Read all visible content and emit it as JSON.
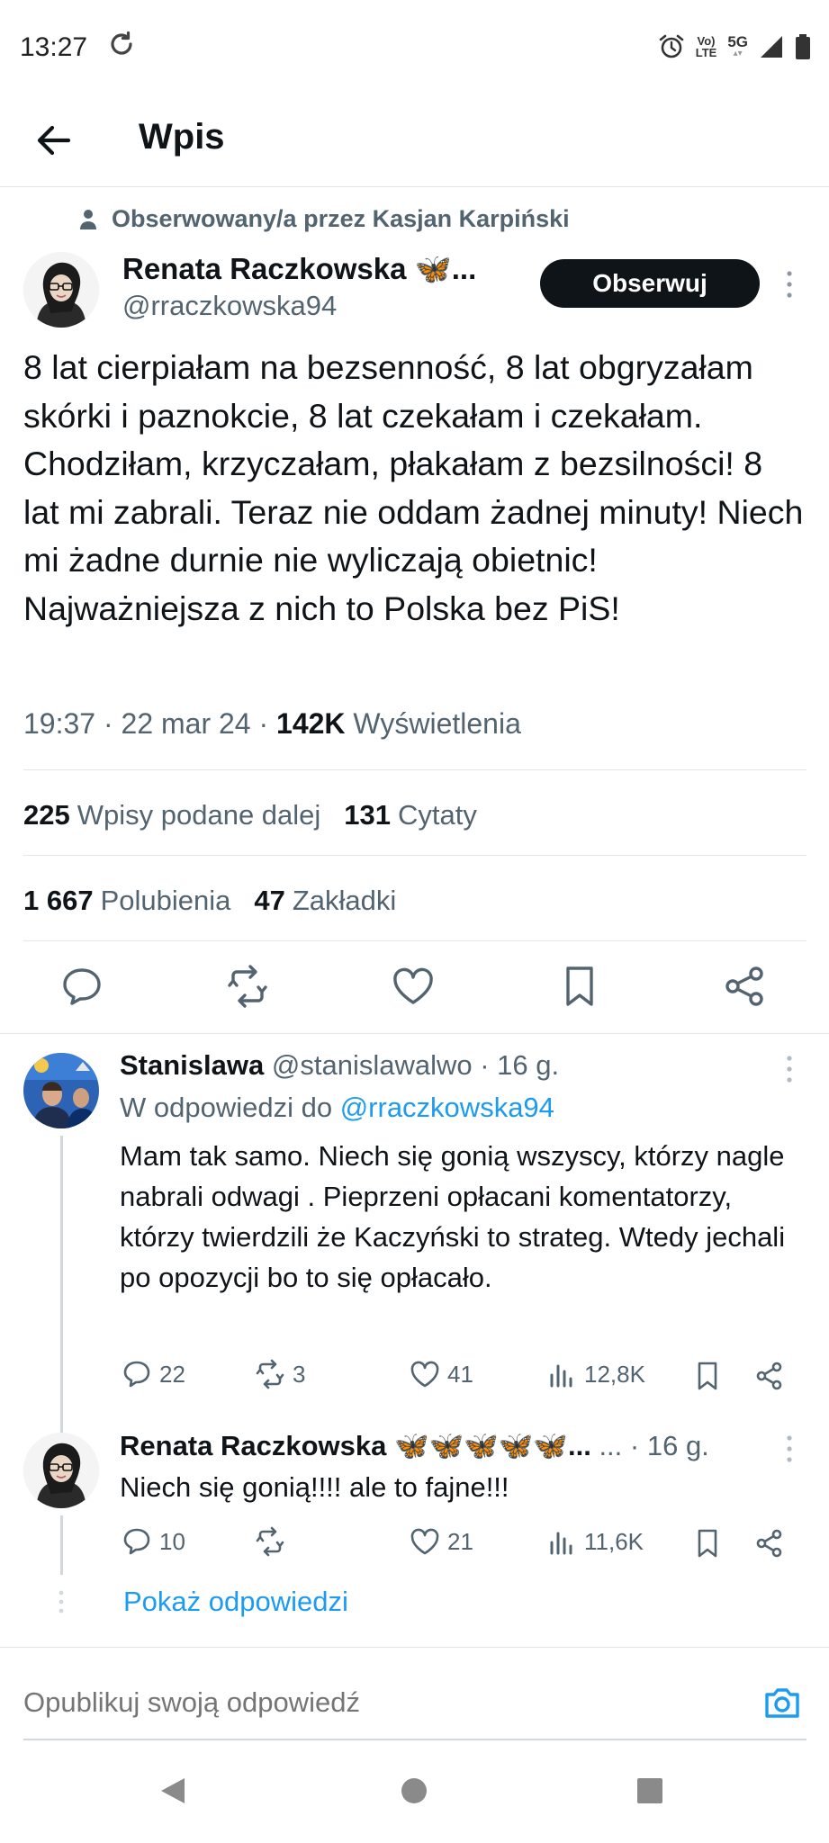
{
  "status_bar": {
    "time": "13:27",
    "network": "Vo​LTE",
    "network_top": "Vo)",
    "network_bottom": "LTE",
    "signal_type": "5G",
    "icons": [
      "sync-icon",
      "alarm-icon",
      "volte-icon",
      "signal-icon",
      "battery-icon"
    ]
  },
  "app_bar": {
    "title": "Wpis",
    "back_icon": "arrow-left-icon"
  },
  "tweet": {
    "followed_by": "Obserwowany/a przez Kasjan Karpiński",
    "author_name": "Renata Raczkowska 🦋...",
    "author_handle": "@rraczkowska94",
    "follow_label": "Obserwuj",
    "text": "8 lat cierpiałam na bezsenność, 8 lat obgryzałam skórki i paznokcie, 8 lat czekałam i czekałam. Chodziłam, krzyczałam, płakałam z bezsilności! 8 lat mi zabrali. Teraz nie oddam żadnej minuty! Niech mi żadne durnie nie wyliczają obietnic! Najważniejsza z nich to Polska bez PiS!",
    "time": "19:37",
    "date": "22 mar 24",
    "views_count": "142K",
    "views_label": "Wyświetlenia",
    "reposts_count": "225",
    "reposts_label": "Wpisy podane dalej",
    "quotes_count": "131",
    "quotes_label": "Cytaty",
    "likes_count": "1 667",
    "likes_label": "Polubienia",
    "bookmarks_count": "47",
    "bookmarks_label": "Zakładki"
  },
  "replies": [
    {
      "name": "Stanislawa",
      "handle": "@stanislawalwo",
      "time": "16 g.",
      "reply_to_label": "W odpowiedzi do",
      "reply_to_handle": "@rraczkowska94",
      "text": "Mam tak samo. Niech się gonią wszyscy, którzy nagle nabrali odwagi . Pieprzeni opłacani komentatorzy, którzy twierdzili że Kaczyński to strateg. Wtedy jechali po opozycji bo to się opłacało.",
      "replies": "22",
      "reposts": "3",
      "likes": "41",
      "views": "12,8K"
    },
    {
      "name": "Renata Raczkowska 🦋🦋🦋🦋🦋...",
      "handle_ellipsis": "...",
      "time": "16 g.",
      "text": "Niech się gonią!!!! ale to fajne!!!",
      "replies": "10",
      "reposts": "",
      "likes": "21",
      "views": "11,6K"
    }
  ],
  "show_replies": "Pokaż odpowiedzi",
  "compose": {
    "placeholder": "Opublikuj swoją odpowiedź"
  },
  "colors": {
    "accent": "#1d9bf0",
    "text": "#0f1419",
    "secondary": "#536471",
    "divider": "#e1e6ea"
  }
}
